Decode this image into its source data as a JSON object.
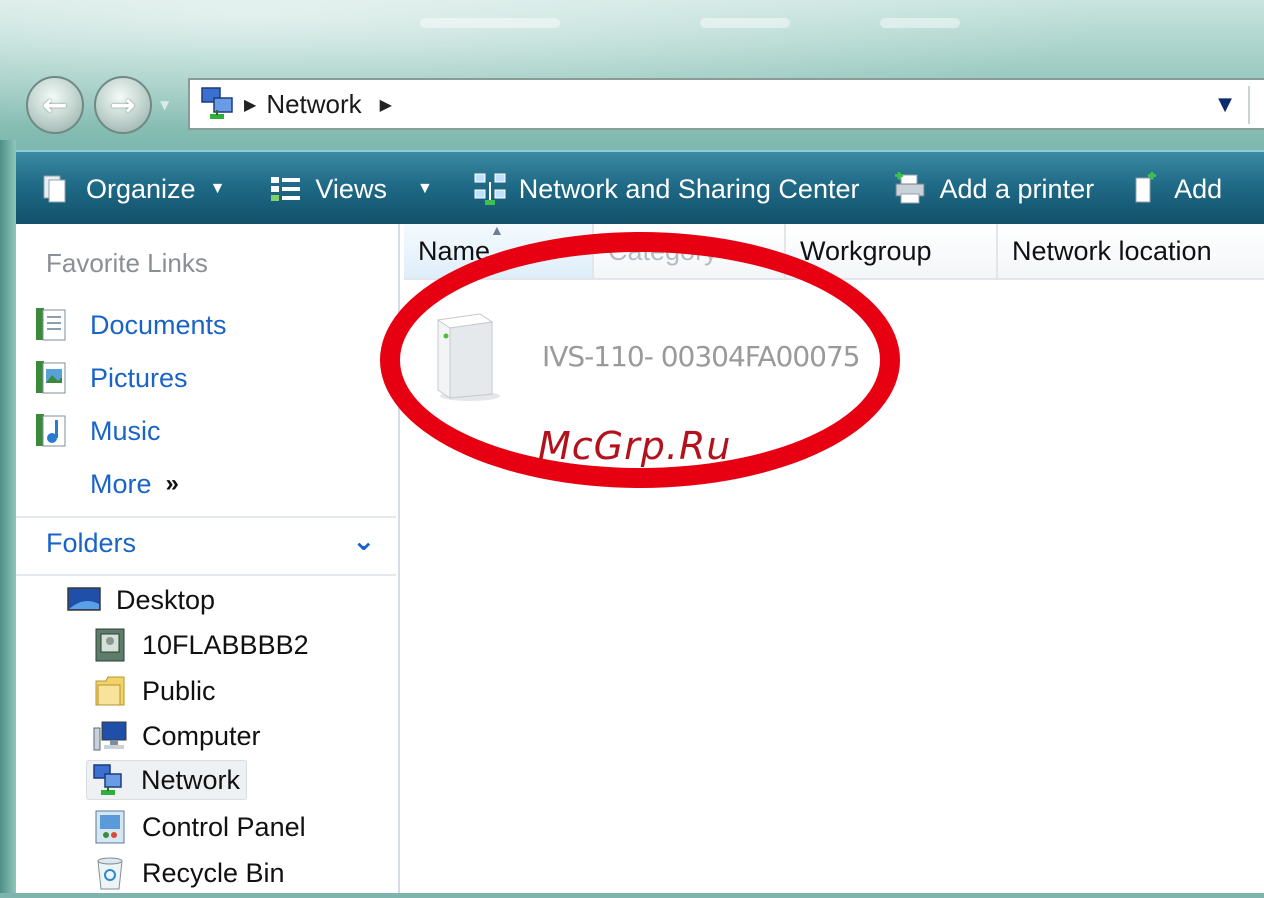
{
  "address": {
    "location": "Network"
  },
  "toolbar": {
    "items": [
      {
        "label": "Organize",
        "icon": "organize-icon",
        "dropdown": true
      },
      {
        "label": "Views",
        "icon": "views-icon",
        "dropdown": true
      },
      {
        "label": "Network and Sharing Center",
        "icon": "network-sharing-icon",
        "dropdown": false
      },
      {
        "label": "Add a printer",
        "icon": "printer-icon",
        "dropdown": false
      },
      {
        "label": "Add",
        "icon": "add-device-icon",
        "dropdown": false
      }
    ]
  },
  "favorites": {
    "title": "Favorite Links",
    "items": [
      {
        "label": "Documents",
        "icon": "documents-icon"
      },
      {
        "label": "Pictures",
        "icon": "pictures-icon"
      },
      {
        "label": "Music",
        "icon": "music-icon"
      },
      {
        "label": "More",
        "icon": "double-chevron-right-icon"
      }
    ]
  },
  "folders": {
    "title": "Folders",
    "items": [
      {
        "label": "Desktop",
        "icon": "desktop-icon",
        "indent": 0
      },
      {
        "label": "10FLABBBB2",
        "icon": "user-folder-icon",
        "indent": 1
      },
      {
        "label": "Public",
        "icon": "public-folder-icon",
        "indent": 1
      },
      {
        "label": "Computer",
        "icon": "computer-icon",
        "indent": 1
      },
      {
        "label": "Network",
        "icon": "network-icon",
        "indent": 1,
        "selected": true
      },
      {
        "label": "Control Panel",
        "icon": "control-panel-icon",
        "indent": 1
      },
      {
        "label": "Recycle Bin",
        "icon": "recycle-bin-icon",
        "indent": 1
      }
    ]
  },
  "columns": [
    "Name",
    "Category",
    "Workgroup",
    "Network location"
  ],
  "device": {
    "label": "IVS-110- 00304FA00075",
    "icon": "network-device-icon"
  },
  "watermark": "McGrp.Ru",
  "colors": {
    "annotation": "#e60012",
    "link": "#1a64c8",
    "toolbar": "#1f6a86"
  }
}
